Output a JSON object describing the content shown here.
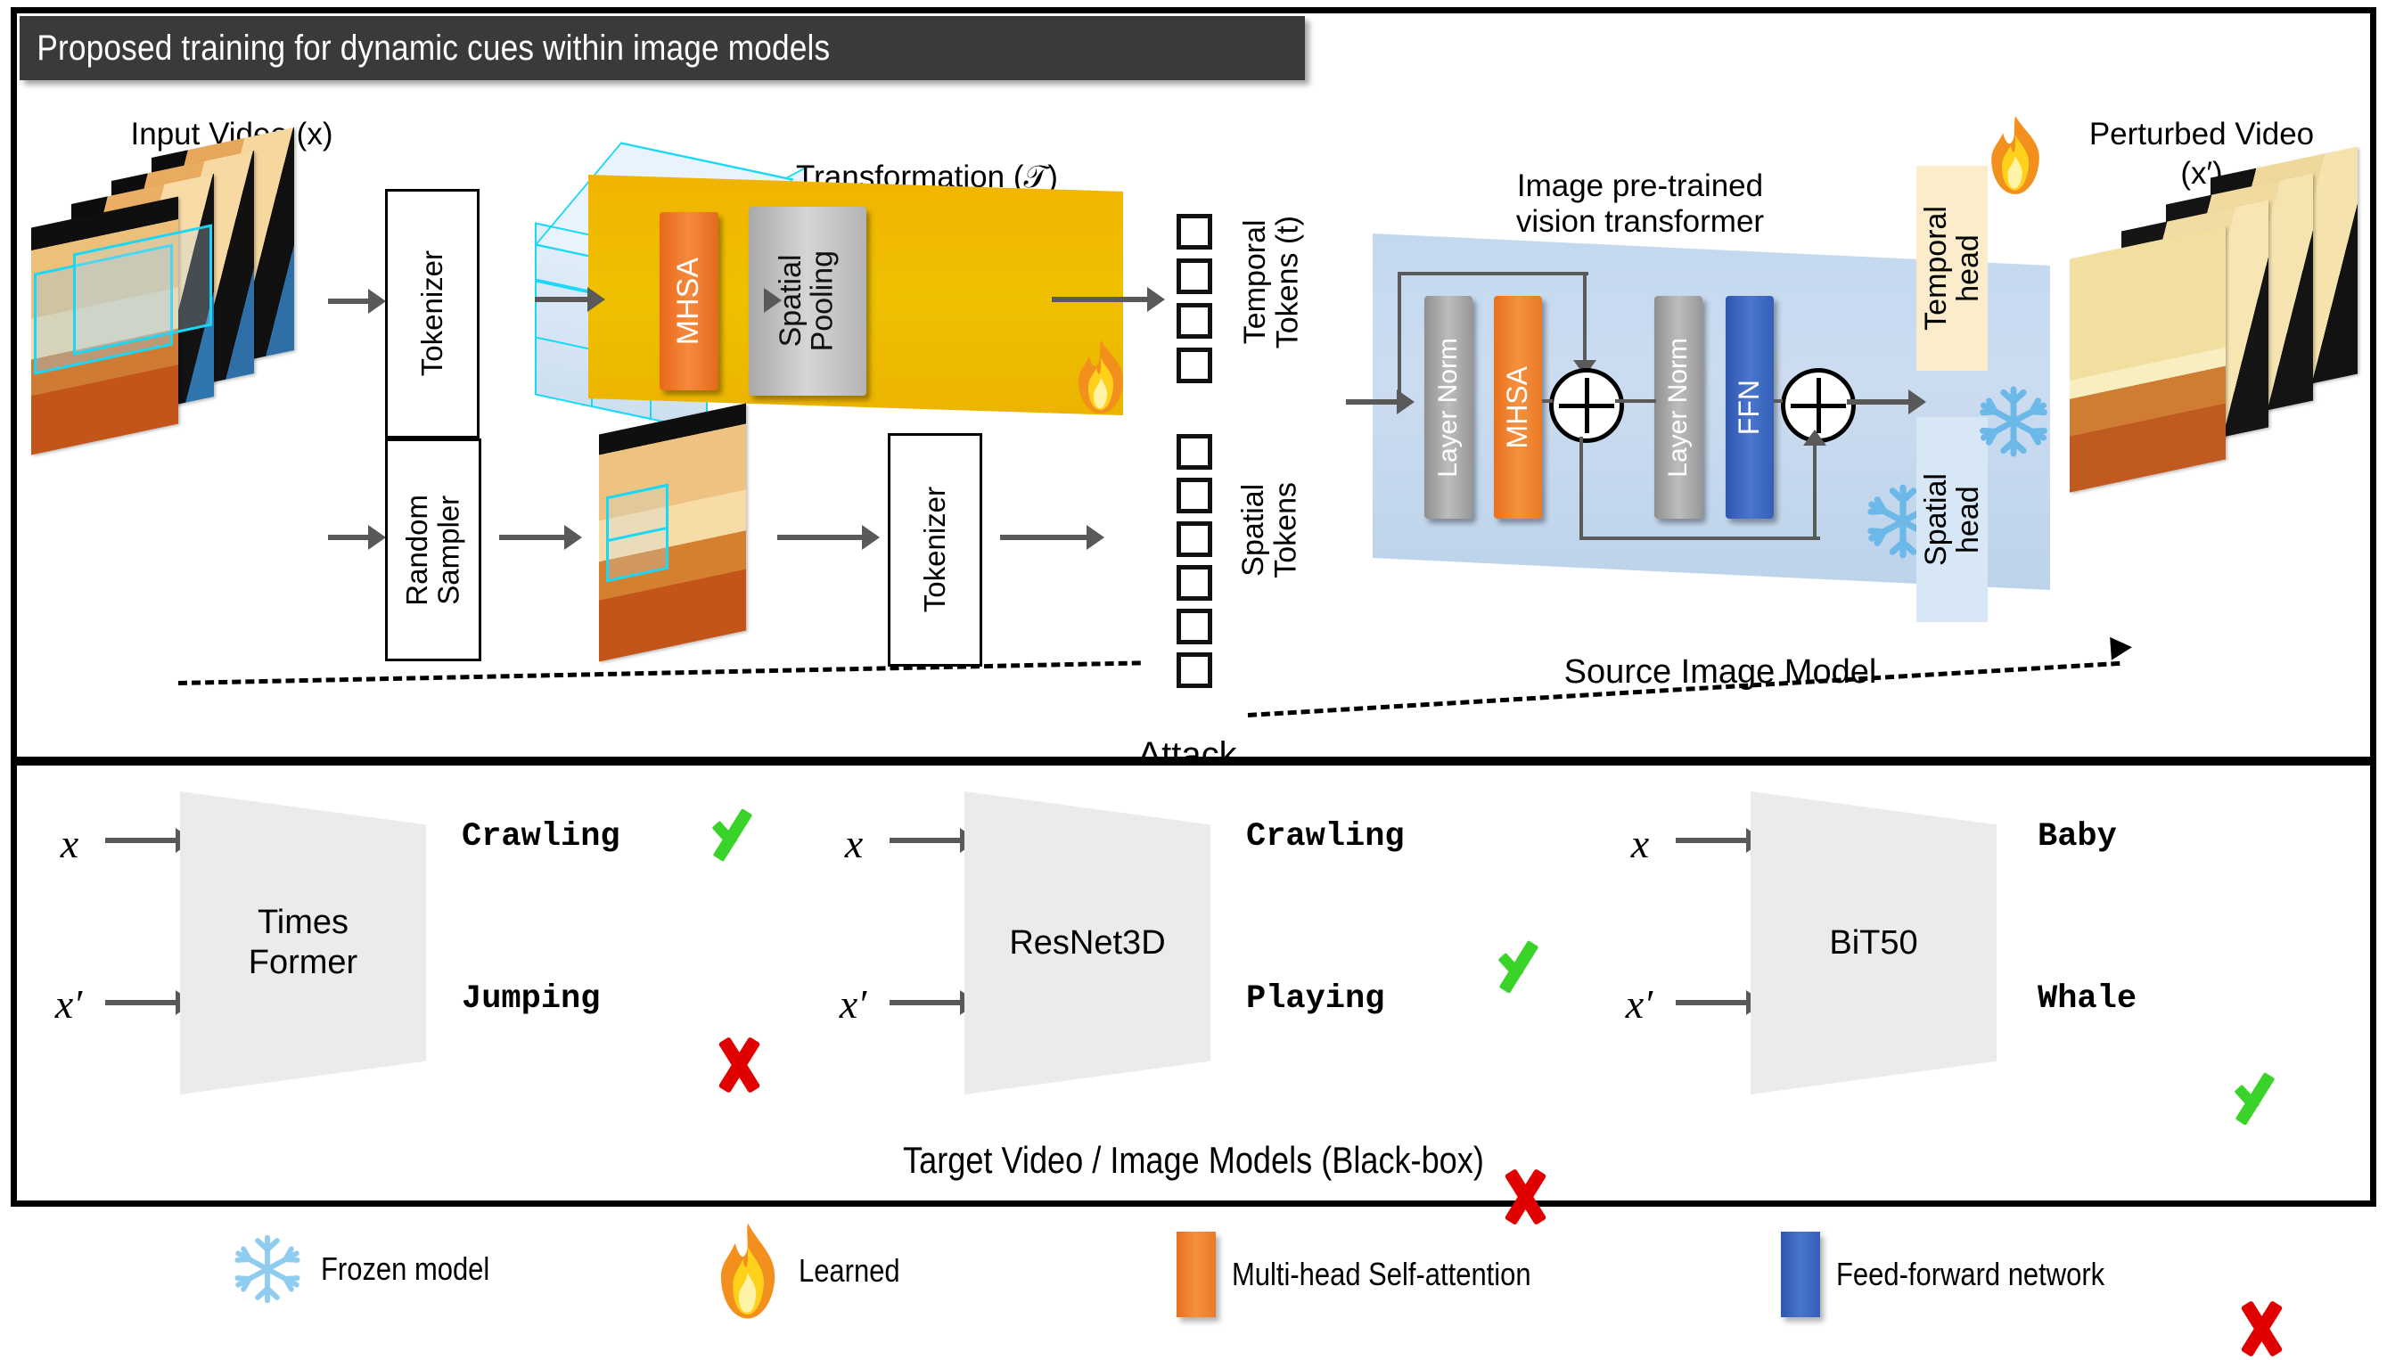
{
  "title": "Proposed training for dynamic cues within image models",
  "top_panel": {
    "input_video_label": "Input Video (x)",
    "tokenizer_top_label": "Tokenizer",
    "random_sampler_label": "Random\nSampler",
    "tokenizer_bottom_label": "Tokenizer",
    "transformation_label": "Transformation (𝒯)",
    "transformation_blocks": {
      "mhsa": "MHSA",
      "spatial_pooling": "Spatial\nPooling"
    },
    "temporal_tokens_label": "Temporal\nTokens (t)",
    "spatial_tokens_label": "Spatial\nTokens",
    "vit_title": "Image pre-trained\nvision transformer",
    "vit_blocks": {
      "layer_norm_1": "Layer Norm",
      "mhsa": "MHSA",
      "layer_norm_2": "Layer Norm",
      "ffn": "FFN"
    },
    "source_model_label": "Source Image Model",
    "temporal_head_label": "Temporal\nhead",
    "spatial_head_label": "Spatial\nhead",
    "perturbed_video_label": "Perturbed Video",
    "perturbed_video_sub": "(x′)",
    "attack_label": "Attack"
  },
  "bottom_panel": {
    "caption": "Target Video / Image Models (Black-box)",
    "input_clean": "x",
    "input_adv": "x′",
    "models": [
      {
        "name": "Times\nFormer",
        "clean_pred": "Crawling",
        "clean_status": "correct",
        "adv_pred": "Jumping",
        "adv_status": "wrong"
      },
      {
        "name": "ResNet3D",
        "clean_pred": "Crawling",
        "clean_status": "correct",
        "adv_pred": "Playing",
        "adv_status": "wrong"
      },
      {
        "name": "BiT50",
        "clean_pred": "Baby",
        "clean_status": "correct",
        "adv_pred": "Whale",
        "adv_status": "wrong"
      }
    ]
  },
  "legend": [
    {
      "icon": "snowflake-icon",
      "label": "Frozen model"
    },
    {
      "icon": "flame-icon",
      "label": "Learned"
    },
    {
      "icon": "orange-swatch",
      "label": "Multi-head Self-attention"
    },
    {
      "icon": "blue-swatch",
      "label": "Feed-forward network"
    }
  ],
  "colors": {
    "title_bar": "#3a3a3a",
    "mhsa_orange": "#ef7c22",
    "ffn_blue": "#3a66c0",
    "layer_norm_gray": "#9b9b9b",
    "transformation_yellow": "#efb800",
    "vit_blue": "#c6daef",
    "temporal_head_cream": "#fcefcf",
    "spatial_head_blue": "#d6e5f5",
    "cyan": "#19d7f7",
    "check_green": "#3ad32a",
    "cross_red": "#e00000",
    "arrow_gray": "#595959",
    "model_gray": "#ebebeb"
  }
}
